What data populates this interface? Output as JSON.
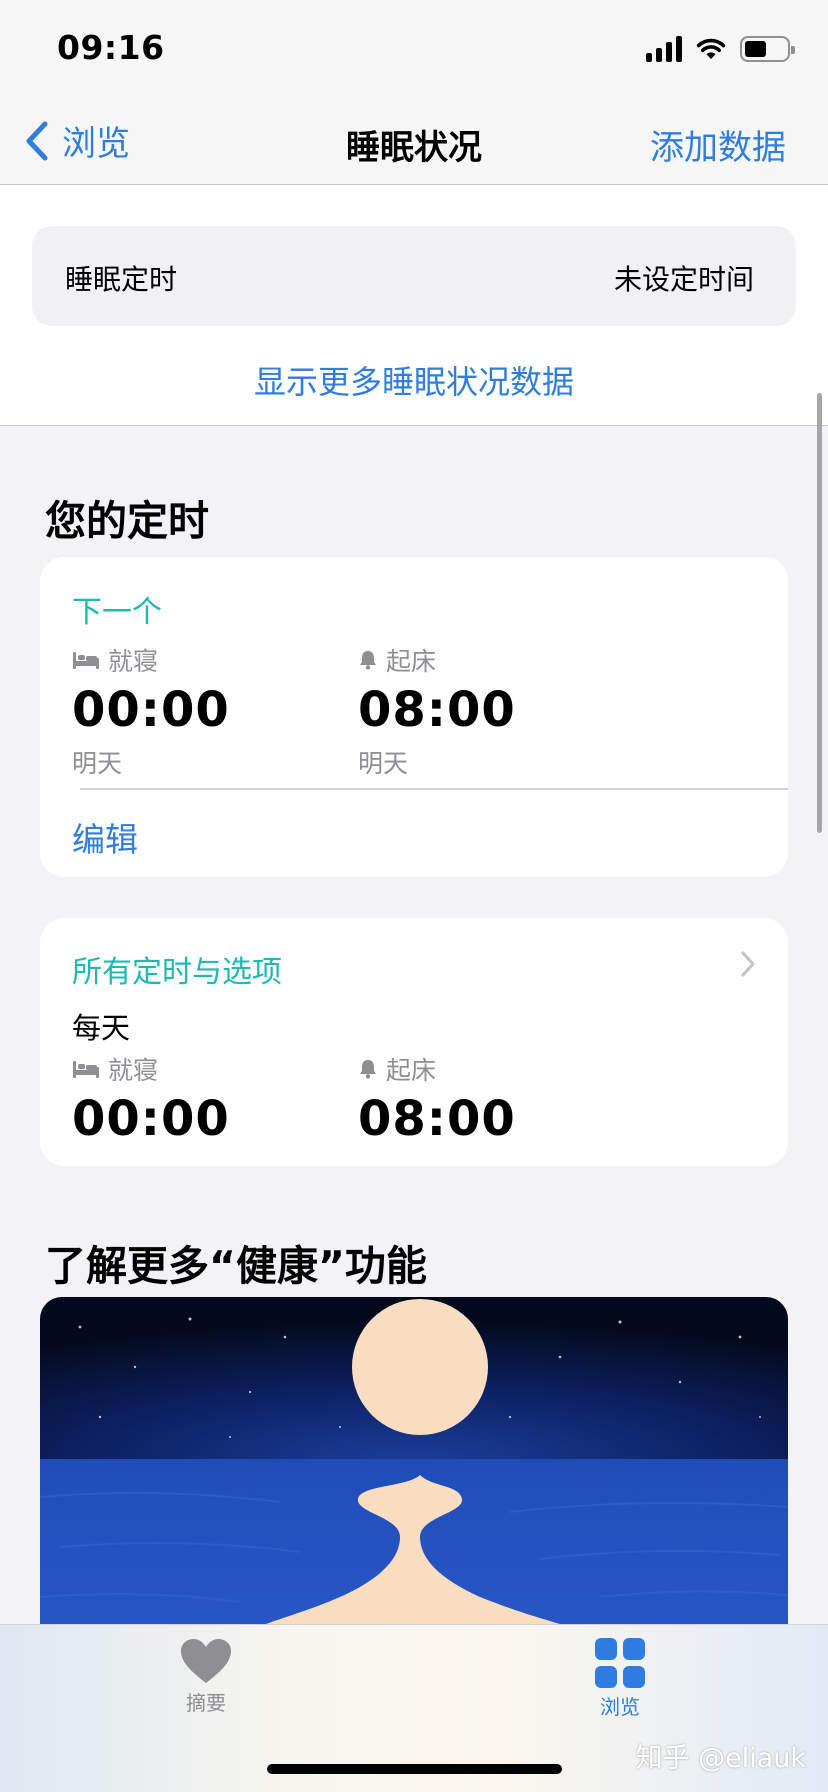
{
  "status_bar": {
    "time": "09:16",
    "battery_level": 0.55
  },
  "nav": {
    "back_label": "浏览",
    "title": "睡眠状况",
    "add_label": "添加数据"
  },
  "sleep_schedule": {
    "label": "睡眠定时",
    "value": "未设定时间"
  },
  "show_more_label": "显示更多睡眠状况数据",
  "your_schedule": {
    "title": "您的定时",
    "next_card": {
      "heading": "下一个",
      "bedtime": {
        "label": "就寝",
        "time": "00:00",
        "day": "明天"
      },
      "wake": {
        "label": "起床",
        "time": "08:00",
        "day": "明天"
      },
      "edit_label": "编辑"
    },
    "all_card": {
      "heading": "所有定时与选项",
      "frequency": "每天",
      "bedtime": {
        "label": "就寝",
        "time": "00:00"
      },
      "wake": {
        "label": "起床",
        "time": "08:00"
      }
    }
  },
  "learn_more": {
    "title": "了解更多“健康”功能"
  },
  "tab_bar": {
    "tabs": [
      {
        "label": "摘要",
        "icon": "heart-icon",
        "selected": false
      },
      {
        "label": "浏览",
        "icon": "grid-icon",
        "selected": true
      }
    ]
  },
  "watermark": "知乎 @eliauk",
  "colors": {
    "accent_blue": "#2f7de1",
    "teal": "#1fb8b2",
    "secondary_gray": "#8e8e93",
    "background": "#f2f2f7"
  }
}
